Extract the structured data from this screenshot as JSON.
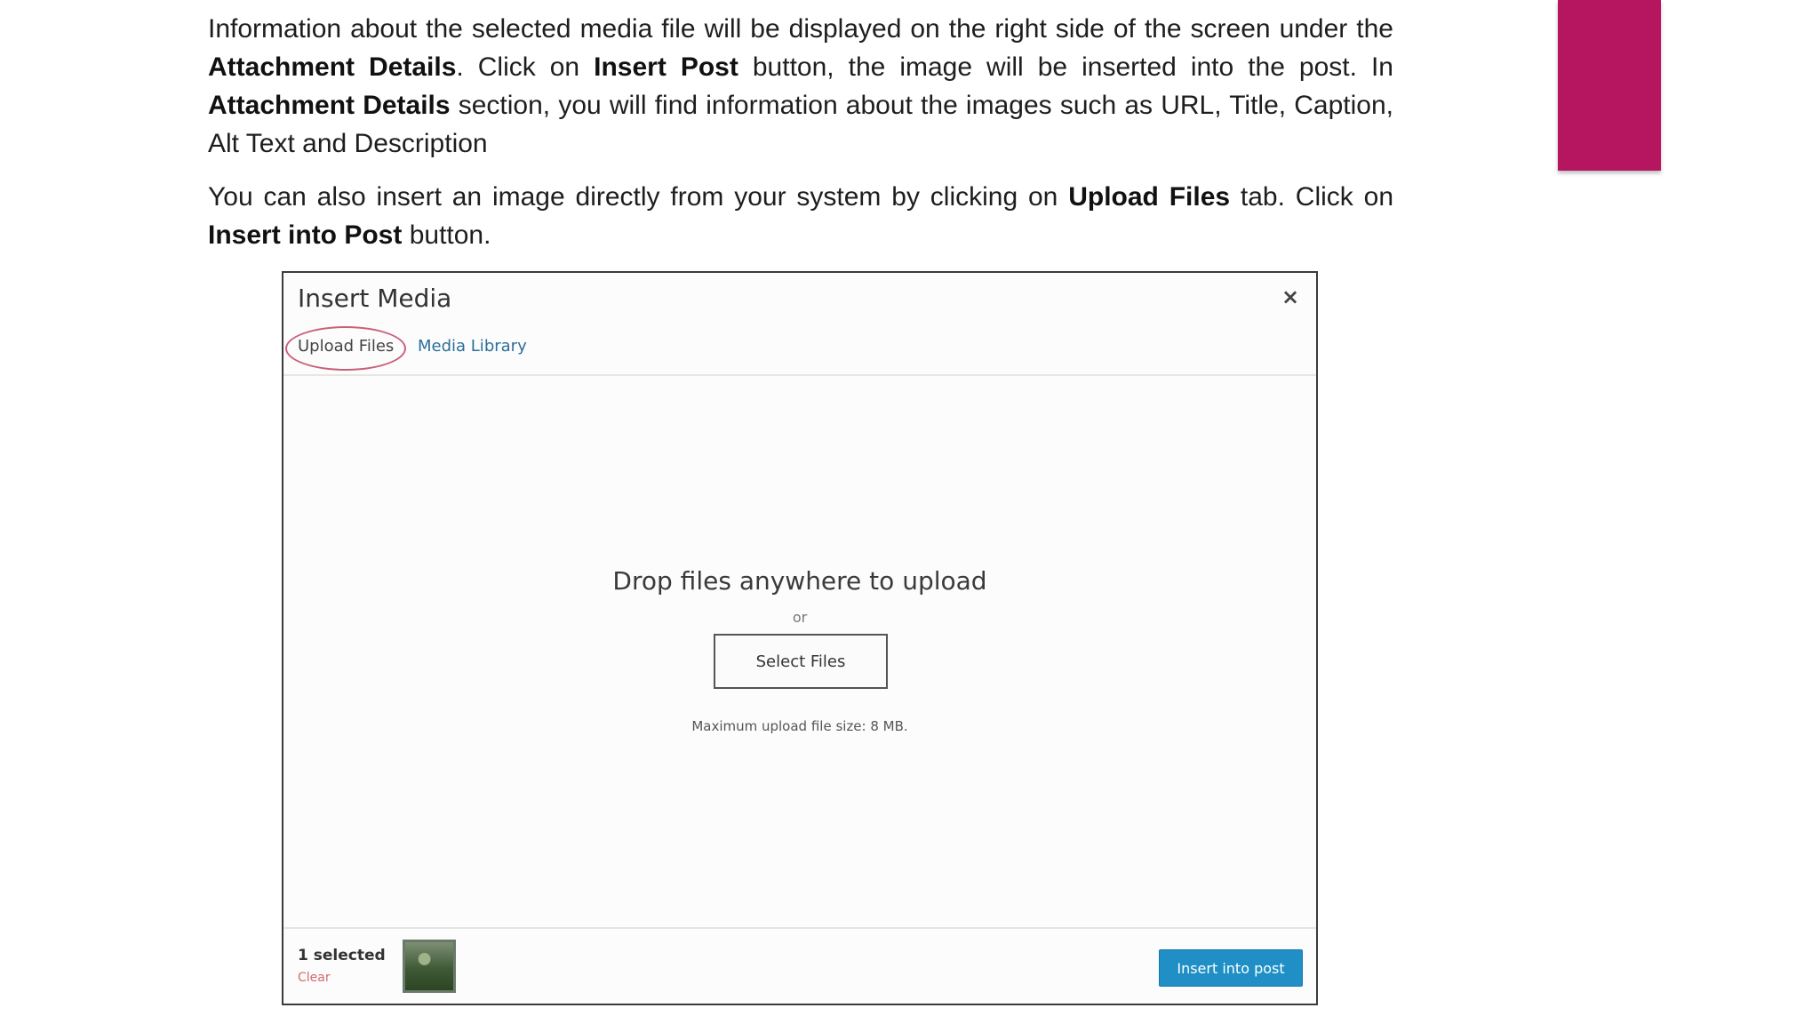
{
  "colors": {
    "accent": "#b5165f",
    "primary_button": "#1f8fc6",
    "link": "#2b6f9a",
    "clear": "#d46a6a"
  },
  "paragraph1": {
    "t1": "Information about the selected media file will be displayed on the right side of the screen under the ",
    "b1": "Attachment Details",
    "t2": ". Click on ",
    "b2": "Insert Post",
    "t3": " button, the image will be inserted into the post. In ",
    "b3": "Attachment Details",
    "t4": " section, you will find information about the images such as URL, Title, Caption, Alt Text and Description"
  },
  "paragraph2": {
    "t1": "You can also insert an image directly from your system by clicking on ",
    "b1": "Upload Files",
    "t2": " tab. Click on ",
    "b2": "Insert into Post",
    "t3": " button."
  },
  "dialog": {
    "title": "Insert Media",
    "close_icon": "close-icon",
    "close_glyph": "×",
    "tabs": [
      {
        "label": "Upload Files",
        "active": true
      },
      {
        "label": "Media Library",
        "active": false
      }
    ],
    "drop_title": "Drop files anywhere to upload",
    "or_text": "or",
    "select_button": "Select Files",
    "max_upload": "Maximum upload file size: 8 MB.",
    "footer": {
      "selected_count": "1 selected",
      "clear_label": "Clear",
      "insert_button": "Insert into post"
    }
  }
}
